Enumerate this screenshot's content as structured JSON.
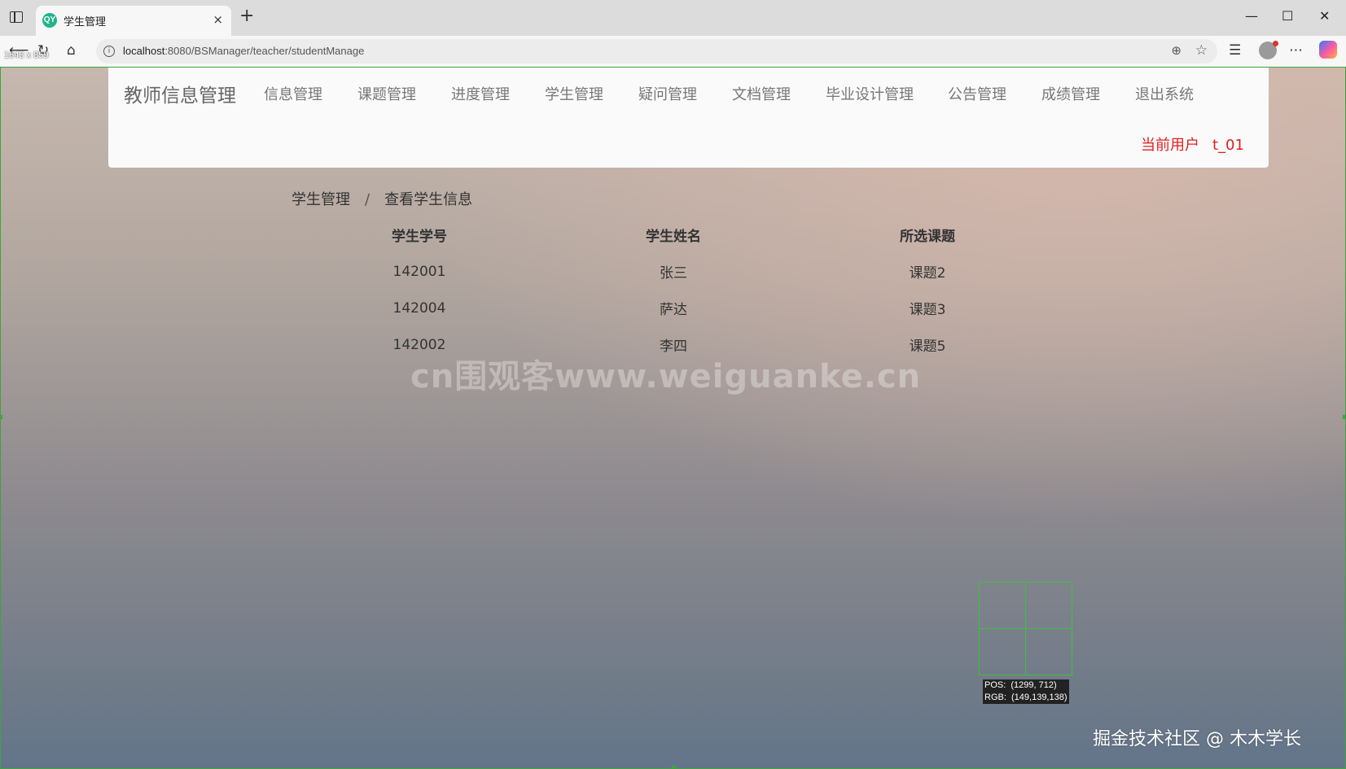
{
  "browser": {
    "tab_title": "学生管理",
    "favicon_text": "QY",
    "tab_close": "×",
    "new_tab": "+",
    "window_controls": {
      "minimize": "—",
      "maximize": "☐",
      "close": "✕"
    },
    "url_host": "localhost",
    "url_path": ":8080/BSManager/teacher/studentManage",
    "dimension_label": "1643 x 859",
    "icons": [
      "back-icon",
      "refresh-icon",
      "home-icon",
      "info-icon",
      "zoom-icon",
      "favorite-star-icon",
      "favorites-icon",
      "profile-icon",
      "more-icon",
      "copilot-icon"
    ]
  },
  "navbar": {
    "brand": "教师信息管理",
    "menu": [
      "信息管理",
      "课题管理",
      "进度管理",
      "学生管理",
      "疑问管理",
      "文档管理",
      "毕业设计管理",
      "公告管理",
      "成绩管理",
      "退出系统"
    ],
    "current_user_label": "当前用户",
    "current_user_value": "t_01",
    "current_user_color": "#e02020"
  },
  "breadcrumb": {
    "parent": "学生管理",
    "separator": "/",
    "current": "查看学生信息"
  },
  "table": {
    "headers": [
      "学生学号",
      "学生姓名",
      "所选课题"
    ],
    "rows": [
      [
        "142001",
        "张三",
        "课题2"
      ],
      [
        "142004",
        "萨达",
        "课题3"
      ],
      [
        "142002",
        "李四",
        "课题5"
      ]
    ]
  },
  "overlay": {
    "watermark": "cn围观客www.weiguanke.cn",
    "pos_readout": "POS:  (1299, 712)",
    "rgb_readout": "RGB:  (149,139,138)",
    "footer_credit": "掘金技术社区 @ 木木学长"
  }
}
